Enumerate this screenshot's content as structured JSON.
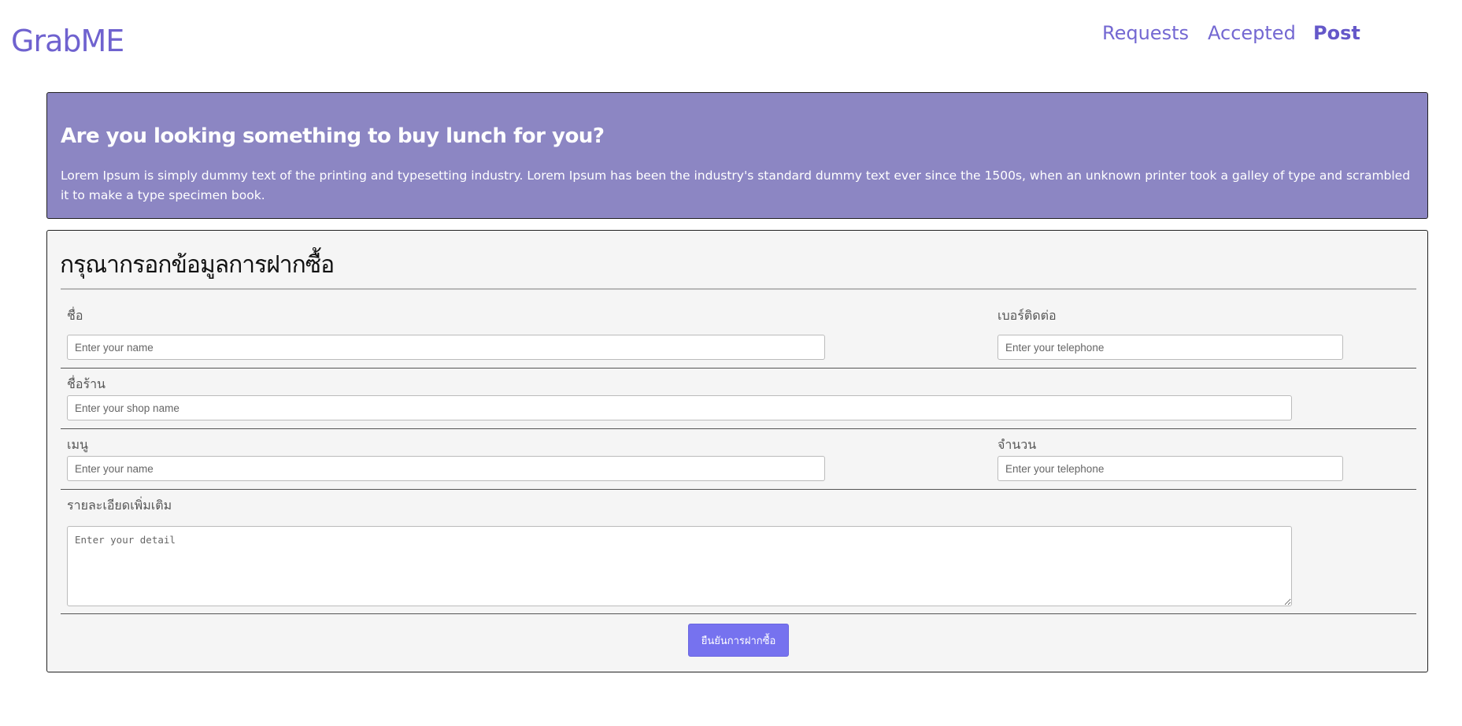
{
  "app": {
    "brand": "GrabME"
  },
  "nav": {
    "items": [
      {
        "label": "Requests",
        "active": false
      },
      {
        "label": "Accepted",
        "active": false
      },
      {
        "label": "Post",
        "active": true
      }
    ]
  },
  "hero": {
    "title": "Are you looking something to buy lunch for you?",
    "text": "Lorem Ipsum is simply dummy text of the printing and typesetting industry. Lorem Ipsum has been the industry's standard dummy text ever since the 1500s, when an unknown printer took a galley of type and scrambled it to make a type specimen book."
  },
  "form": {
    "title": "กรุณากรอกข้อมูลการฝากซื้อ",
    "name": {
      "label": "ชื่อ",
      "placeholder": "Enter your name"
    },
    "phone": {
      "label": "เบอร์ติดต่อ",
      "placeholder": "Enter your telephone"
    },
    "shop": {
      "label": "ชื่อร้าน",
      "placeholder": "Enter your shop name"
    },
    "menu": {
      "label": "เมนู",
      "placeholder": "Enter your name"
    },
    "quantity": {
      "label": "จำนวน",
      "placeholder": "Enter your telephone"
    },
    "detail": {
      "label": "รายละเอียดเพิ่มเติม",
      "placeholder": "Enter your detail"
    },
    "submit_label": "ยืนยันการฝากซื้อ"
  },
  "colors": {
    "brand": "#6f62cf",
    "hero_bg": "#8c86c3",
    "button": "#7672ef",
    "card_bg": "#f5f5f5"
  }
}
